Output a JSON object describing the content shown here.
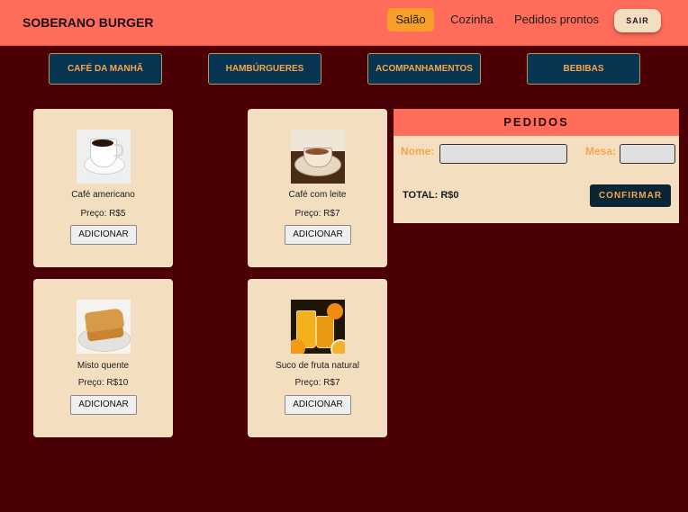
{
  "header": {
    "brand": "SOBERANO BURGER",
    "tabs": [
      {
        "label": "Salão",
        "active": true
      },
      {
        "label": "Cozinha",
        "active": false
      },
      {
        "label": "Pedidos prontos",
        "active": false
      }
    ],
    "logout_label": "SAIR"
  },
  "categories": [
    "CAFÉ DA MANHÃ",
    "HAMBÚRGUERES",
    "ACOMPANHAMENTOS",
    "BEBIBAS"
  ],
  "products": [
    {
      "name": "Café americano",
      "price": "Preço: R$5",
      "button": "ADICIONAR",
      "icon": "coffee-cup-photo"
    },
    {
      "name": "Café com leite",
      "price": "Preço: R$7",
      "button": "ADICIONAR",
      "icon": "latte-cup-photo"
    },
    {
      "name": "Misto quente",
      "price": "Preço: R$10",
      "button": "ADICIONAR",
      "icon": "grilled-sandwich-photo"
    },
    {
      "name": "Suco de fruta natural",
      "price": "Preço: R$7",
      "button": "ADICIONAR",
      "icon": "orange-juice-photo"
    }
  ],
  "order_panel": {
    "title": "PEDIDOS",
    "name_label": "Nome:",
    "name_value": "",
    "table_label": "Mesa:",
    "table_value": "",
    "total": "TOTAL: R$0",
    "confirm_label": "CONFIRMAR"
  },
  "colors": {
    "background": "#4a0004",
    "header": "#ff6d5a",
    "active_tab": "#f7a029",
    "card": "#f3dfc0",
    "category_button": "#083551",
    "accent_text": "#f5a64a"
  }
}
